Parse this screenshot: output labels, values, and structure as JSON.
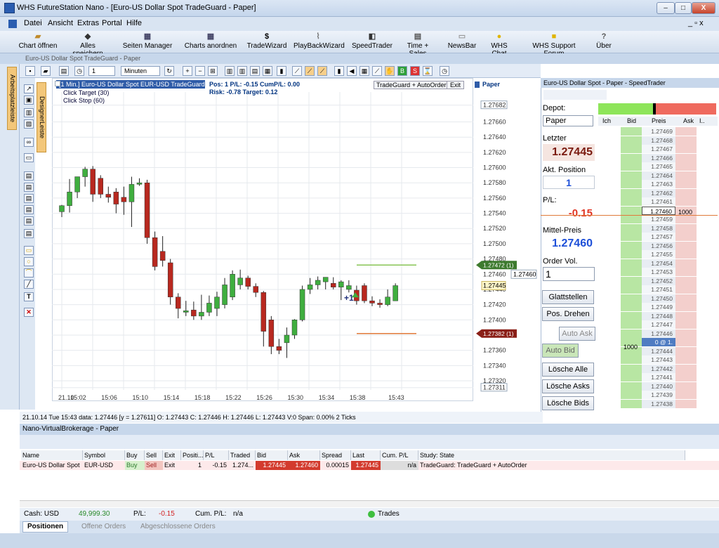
{
  "window": {
    "title": "WHS FutureStation Nano - [Euro-US Dollar Spot  TradeGuard - Paper]",
    "min": "–",
    "max": "□",
    "close": "X"
  },
  "menu": [
    "Datei",
    "Ansicht",
    "Extras",
    "Portal",
    "Hilfe"
  ],
  "menu_right": "_ ▫ x",
  "toolbar": [
    "Chart öffnen",
    "Alles speichern",
    "Seiten Manager",
    "Charts anordnen",
    "TradeWizard",
    "PlayBackWizard",
    "SpeedTrader",
    "Time + Sales",
    "NewsBar",
    "WHS Chat",
    "WHS Support Forum",
    "Über"
  ],
  "doc_title": "Euro-US Dollar Spot  TradeGuard - Paper",
  "chart_toolbar": {
    "interval_value": "1",
    "interval_unit": "Minuten"
  },
  "side_tabs": {
    "left": "Arbeitsplatzleiste",
    "design": "DesignerLeiste"
  },
  "chart_header": {
    "instrument": "[1 Min.] Euro-US Dollar Spot  EUR-USD TradeGuard",
    "line2": "Click Target  (30)",
    "line3": "Click Stop  (60)",
    "pos": "Pos: 1  P/L: -0.15  CumP/L: 0.00",
    "risk": "Risk:  -0.78  Target:  0.12",
    "tg_button": "TradeGuard + AutoOrder",
    "exit_button": "Exit",
    "paper": "Paper",
    "position_marker": "+1"
  },
  "chart_data": {
    "type": "candlestick",
    "x": [
      "15:00",
      "15:01",
      "15:02",
      "15:03",
      "15:04",
      "15:05",
      "15:06",
      "15:07",
      "15:08",
      "15:09",
      "15:10",
      "15:11",
      "15:12",
      "15:13",
      "15:14",
      "15:15",
      "15:16",
      "15:17",
      "15:18",
      "15:19",
      "15:20",
      "15:21",
      "15:22",
      "15:23",
      "15:24",
      "15:25",
      "15:26",
      "15:27",
      "15:28",
      "15:29",
      "15:30",
      "15:31",
      "15:32",
      "15:33",
      "15:34",
      "15:35",
      "15:36",
      "15:37",
      "15:38",
      "15:39",
      "15:40",
      "15:41",
      "15:42",
      "15:43"
    ],
    "series": [
      {
        "open": [
          1.27542,
          1.2755,
          1.27568,
          1.27588,
          1.27598,
          1.27586,
          1.27565,
          1.27568,
          1.27561,
          1.27555,
          1.27578,
          1.2758,
          1.27508,
          1.2749,
          1.27475,
          1.2743,
          1.2741,
          1.27413,
          1.27405,
          1.2741,
          1.27415,
          1.2742,
          1.2743,
          1.27446,
          1.27455,
          1.27444,
          1.27436,
          1.274,
          1.27365,
          1.2737,
          1.2738,
          1.274,
          1.2744,
          1.27446,
          1.2745,
          1.27448,
          1.27443,
          1.2744,
          1.27439,
          1.27445,
          1.27425,
          1.27422,
          1.2742,
          1.27425
        ],
        "high": [
          1.27551,
          1.27585,
          1.27578,
          1.27601,
          1.27602,
          1.2759,
          1.27575,
          1.27573,
          1.27575,
          1.27588,
          1.27586,
          1.27584,
          1.27516,
          1.2751,
          1.2748,
          1.27435,
          1.27425,
          1.27424,
          1.27433,
          1.27432,
          1.27437,
          1.27455,
          1.27465,
          1.27466,
          1.27458,
          1.27448,
          1.27438,
          1.27405,
          1.27375,
          1.2739,
          1.27401,
          1.27445,
          1.27455,
          1.27457,
          1.27456,
          1.27456,
          1.27452,
          1.27452,
          1.27445,
          1.27448,
          1.27431,
          1.27427,
          1.2744,
          1.27448
        ],
        "low": [
          1.27535,
          1.27541,
          1.2756,
          1.27575,
          1.27555,
          1.2756,
          1.27554,
          1.2754,
          1.27538,
          1.27522,
          1.27576,
          1.275,
          1.27465,
          1.2747,
          1.2742,
          1.27402,
          1.27405,
          1.274,
          1.274,
          1.27405,
          1.27405,
          1.27415,
          1.27426,
          1.2744,
          1.2744,
          1.2743,
          1.27365,
          1.27355,
          1.27355,
          1.2735,
          1.27375,
          1.27398,
          1.27434,
          1.2744,
          1.2744,
          1.2744,
          1.27426,
          1.27436,
          1.2742,
          1.27422,
          1.27418,
          1.27416,
          1.27418,
          1.27443
        ],
        "close": [
          1.2755,
          1.27568,
          1.27588,
          1.27598,
          1.27565,
          1.27565,
          1.27561,
          1.27552,
          1.27555,
          1.27578,
          1.2758,
          1.27508,
          1.2747,
          1.27478,
          1.2743,
          1.27415,
          1.27412,
          1.27405,
          1.2741,
          1.27422,
          1.2743,
          1.27446,
          1.2746,
          1.27455,
          1.27444,
          1.27436,
          1.27385,
          1.27365,
          1.2736,
          1.2738,
          1.274,
          1.2744,
          1.27446,
          1.27452,
          1.27456,
          1.27443,
          1.2745,
          1.27445,
          1.27425,
          1.27425,
          1.27422,
          1.2742,
          1.2743,
          1.27445
        ]
      }
    ],
    "y_ticks": [
      "1.27682",
      "1.27660",
      "1.27640",
      "1.27620",
      "1.27600",
      "1.27580",
      "1.27560",
      "1.27540",
      "1.27520",
      "1.27500",
      "1.27480",
      "1.27460",
      "1.27440",
      "1.27420",
      "1.27400",
      "1.27380",
      "1.27360",
      "1.27340",
      "1.27320",
      "1.27311"
    ],
    "x_ticks": [
      "21.10.",
      "15:02",
      "15:06",
      "15:10",
      "15:14",
      "15:18",
      "15:22",
      "15:26",
      "15:30",
      "15:34",
      "15:38",
      "15:43"
    ],
    "ylim": [
      1.27308,
      1.2769
    ],
    "target_line": 1.27472,
    "stop_line": 1.27382,
    "target_label": "1.27472 (1)",
    "stop_label": "1.27382 (1)",
    "current_label": "1.27445",
    "bid_label": "1.27460",
    "colors": {
      "up": "#3fae3f",
      "down": "#b8281f",
      "target": "#88c455",
      "stop": "#e07a3a"
    }
  },
  "status_line": "21.10.14 Tue  15:43 data: 1.27446 [y = 1.27611]     O: 1.27443 C: 1.27446 H: 1.27446 L: 1.27443 V:0 Span: 0.00% 2 Ticks",
  "speedtrader": {
    "title": "Euro-US Dollar Spot  - Paper - SpeedTrader",
    "depot_label": "Depot:",
    "depot_value": "Paper",
    "letzter_label": "Letzter",
    "letzter_value": "1.27445",
    "akt_label": "Akt. Position",
    "akt_value": "1",
    "pl_label": "P/L:",
    "pl_value": "-0.15",
    "mittel_label": "Mittel-Preis",
    "mittel_value": "1.27460",
    "ordervol_label": "Order Vol.",
    "ordervol_value": "1",
    "buttons": [
      "Glattstellen",
      "Pos. Drehen",
      "Auto Ask",
      "Auto Bid",
      "Lösche Alle",
      "Lösche Asks",
      "Lösche Bids"
    ],
    "ladder_headers": [
      "Ich",
      "Bid",
      "Preis",
      "Ask",
      "I.."
    ],
    "ladder_prices": [
      "1.27469",
      "1.27468",
      "1.27467",
      "1.27466",
      "1.27465",
      "1.27464",
      "1.27463",
      "1.27462",
      "1.27461",
      "1.27460",
      "1.27459",
      "1.27458",
      "1.27457",
      "1.27456",
      "1.27455",
      "1.27454",
      "1.27453",
      "1.27452",
      "1.27451",
      "1.27450",
      "1.27449",
      "1.27448",
      "1.27447",
      "1.27446",
      "0 @ 1.",
      "1.27444",
      "1.27443",
      "1.27442",
      "1.27441",
      "1.27440",
      "1.27439",
      "1.27438"
    ],
    "ask_size": "1000",
    "bid_size": "1000"
  },
  "broker": {
    "title": "Nano-VirtualBrokerage - Paper",
    "headers": [
      "Name",
      "Symbol",
      "Buy",
      "Sell",
      "Exit",
      "Positi...",
      "P/L",
      "Traded",
      "Bid",
      "Ask",
      "Spread",
      "Last",
      "Cum. P/L",
      "Study: State"
    ],
    "row": [
      "Euro-US Dollar Spot",
      "EUR-USD",
      "Buy",
      "Sell",
      "Exit",
      "1",
      "-0.15",
      "1.274...",
      "1.27445",
      "1.27460",
      "0.00015",
      "1.27445",
      "n/a",
      "TradeGuard: TradeGuard + AutoOrder"
    ],
    "cash_label": "Cash:  USD",
    "cash_value": "49,999.30",
    "pl_label": "P/L:",
    "pl_value": "-0.15",
    "cum_label": "Cum. P/L:",
    "cum_value": "n/a",
    "trades": "Trades",
    "tabs": [
      "Positionen",
      "Offene Orders",
      "Abgeschlossene Orders"
    ]
  }
}
